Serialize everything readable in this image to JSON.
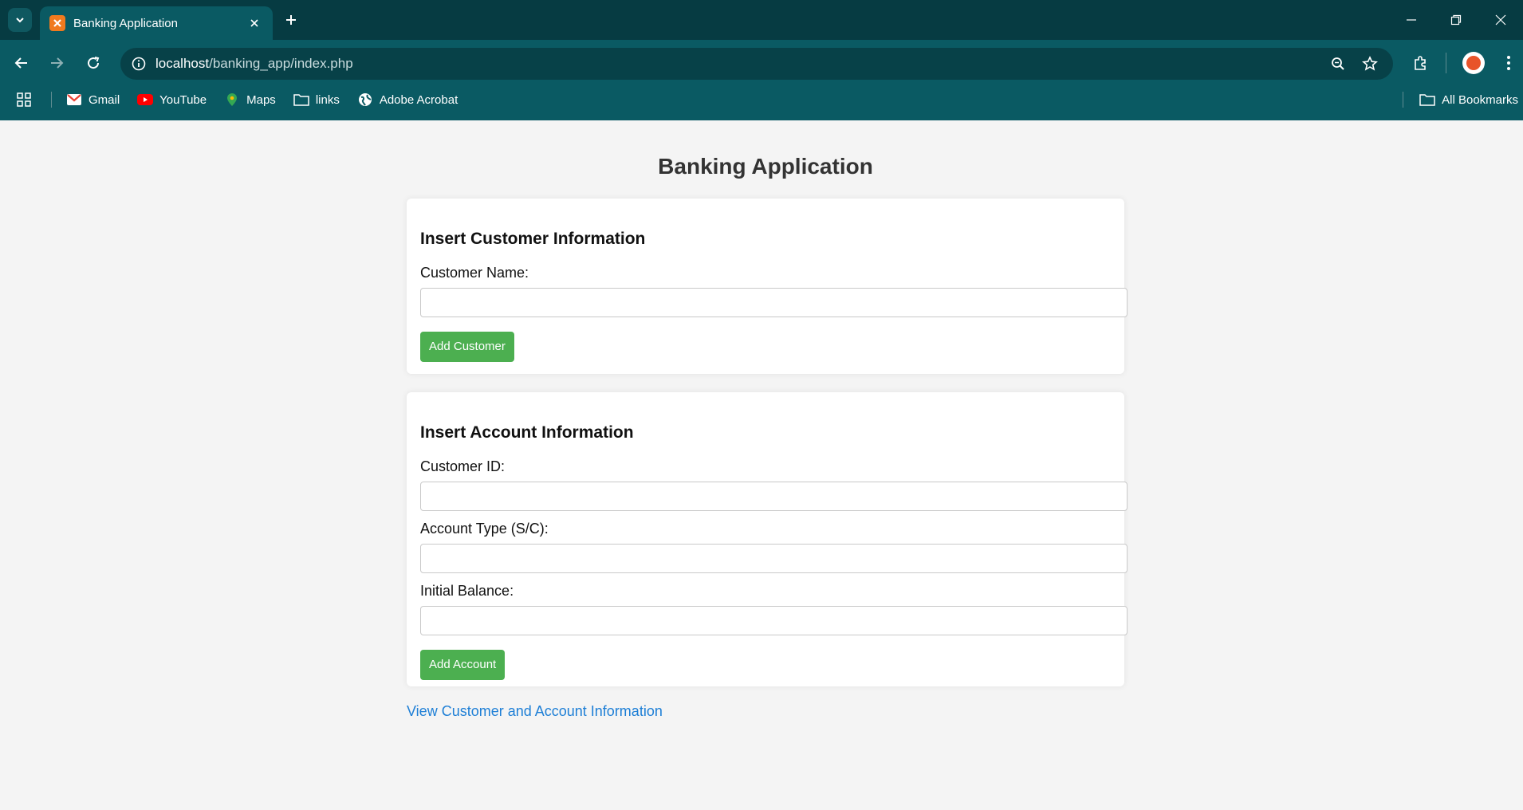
{
  "browser": {
    "tab_title": "Banking Application",
    "url_host": "localhost",
    "url_path": "/banking_app/index.php",
    "bookmarks": [
      {
        "label": "Gmail",
        "icon": "gmail-icon"
      },
      {
        "label": "YouTube",
        "icon": "youtube-icon"
      },
      {
        "label": "Maps",
        "icon": "maps-icon"
      },
      {
        "label": "links",
        "icon": "folder-icon"
      },
      {
        "label": "Adobe Acrobat",
        "icon": "globe-icon"
      }
    ],
    "all_bookmarks": "All Bookmarks"
  },
  "page": {
    "title": "Banking Application",
    "customer_form": {
      "heading": "Insert Customer Information",
      "name_label": "Customer Name:",
      "name_value": "",
      "submit": "Add Customer"
    },
    "account_form": {
      "heading": "Insert Account Information",
      "customer_id_label": "Customer ID:",
      "customer_id_value": "",
      "account_type_label": "Account Type (S/C):",
      "account_type_value": "",
      "initial_balance_label": "Initial Balance:",
      "initial_balance_value": "",
      "submit": "Add Account"
    },
    "view_link": "View Customer and Account Information"
  },
  "colors": {
    "chrome_bg": "#0a5a63",
    "tabstrip_bg": "#063b42",
    "button_green": "#4caf50",
    "link_blue": "#1e7fd6"
  }
}
